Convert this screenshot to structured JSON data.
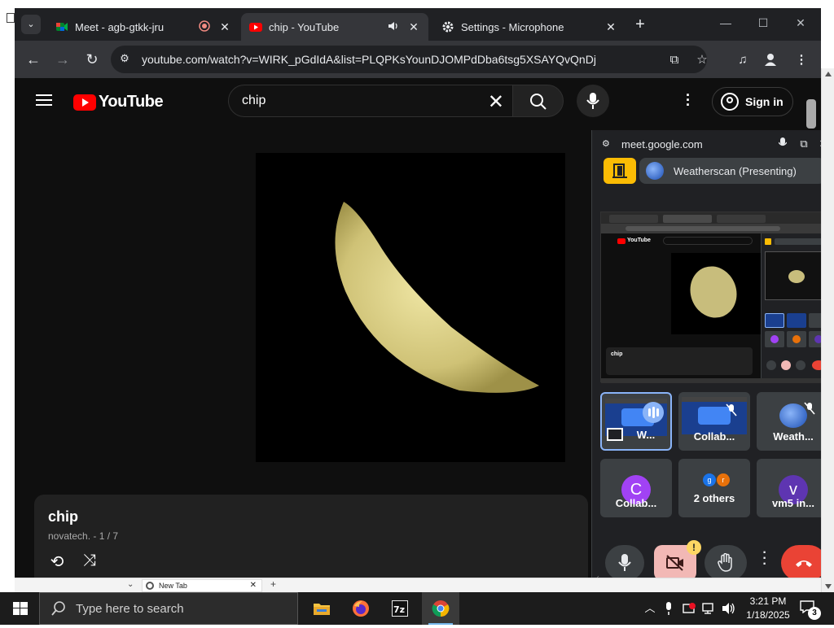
{
  "browser": {
    "tabs": [
      {
        "title": "Meet - agb-gtkk-jru",
        "icon": "google-meet-icon",
        "state": "recording-icon"
      },
      {
        "title": "chip - YouTube",
        "icon": "youtube-icon",
        "state": "audio-playing-icon"
      },
      {
        "title": "Settings - Microphone",
        "icon": "gear-icon"
      }
    ],
    "url": "youtube.com/watch?v=WIRK_pGdIdA&list=PLQPKsYounDJOMPdDba6tsg5XSAYQvQnDj"
  },
  "youtube": {
    "logo_text": "YouTube",
    "search_query": "chip",
    "sign_in_label": "Sign in",
    "video": {
      "title": "chip",
      "channel": "novatech.",
      "playlist_position": "1 / 7",
      "channel_line": "novatech. - 1 / 7"
    }
  },
  "meet_pip": {
    "host": "meet.google.com",
    "presenting_label": "Weatherscan (Presenting)",
    "tiles": [
      {
        "label": "W...",
        "kind": "screen",
        "selected": true,
        "speaking": true
      },
      {
        "label": "Collab...",
        "kind": "screen",
        "muted": true
      },
      {
        "label": "Weath...",
        "kind": "globe",
        "muted": true
      },
      {
        "label": "Collab...",
        "kind": "avatar",
        "initial": "C",
        "color": "#a142f4"
      },
      {
        "label": "2 others",
        "kind": "group",
        "initials": [
          "g",
          "r"
        ],
        "colors": [
          "#1a73e8",
          "#e8710a"
        ]
      },
      {
        "label": "vm5 in...",
        "kind": "avatar",
        "initial": "v",
        "color": "#5e35b1"
      }
    ],
    "warning_badge": "!"
  },
  "downloads_bar": {
    "tab_label": "New Tab"
  },
  "taskbar": {
    "search_placeholder": "Type here to search",
    "apps": [
      "file-explorer-icon",
      "firefox-icon",
      "7zip-icon",
      "chrome-icon"
    ],
    "time": "3:21 PM",
    "date": "1/18/2025",
    "notification_count": "3"
  },
  "colors": {
    "youtube_red": "#ff0000",
    "meet_yellow": "#fbbc04",
    "end_call_red": "#ea4335",
    "selected_tile": "#8ab4f8"
  }
}
